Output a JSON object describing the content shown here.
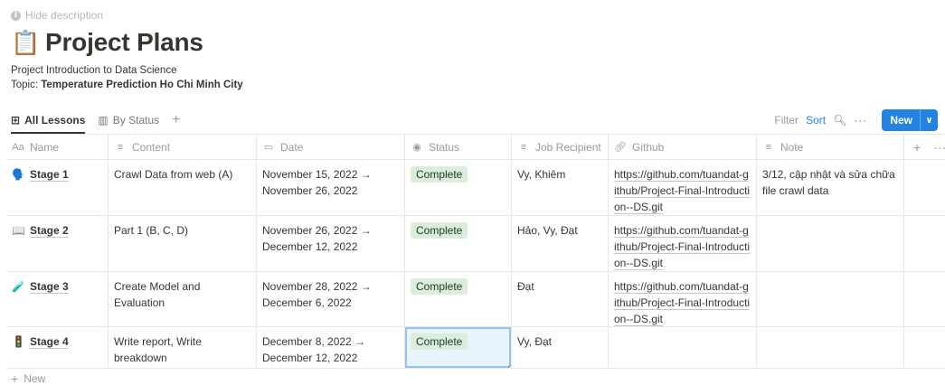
{
  "hide_description": "Hide description",
  "page": {
    "icon": "📋",
    "icon_name": "clipboard-icon",
    "title": "Project Plans",
    "description_line1": "Project Introduction to Data Science",
    "topic_label": "Topic: ",
    "topic_value": "Temperature Prediction Ho Chi Minh City"
  },
  "views": [
    {
      "label": "All Lessons",
      "icon": "table-icon",
      "active": true
    },
    {
      "label": "By Status",
      "icon": "board-icon",
      "active": false
    }
  ],
  "toolbar": {
    "filter": "Filter",
    "sort": "Sort",
    "search_icon": "search-icon",
    "more": "···",
    "new_label": "New",
    "new_chevron": "chevron-down-icon"
  },
  "columns": {
    "name": "Name",
    "content": "Content",
    "date": "Date",
    "status": "Status",
    "job": "Job Recipient",
    "github": "Github",
    "note": "Note"
  },
  "rows": [
    {
      "icon": "🗣️",
      "icon_name": "speaking-head-icon",
      "name": "Stage 1",
      "content": "Crawl Data from web (A)",
      "date": "November 15, 2022 → November 26, 2022",
      "status": "Complete",
      "job": "Vy, Khiêm",
      "github": "https://github.com/tuandat-github/Project-Final-Introduction--DS.git",
      "note": "3/12, cập nhật và sửa chữa file crawl data"
    },
    {
      "icon": "📖",
      "icon_name": "open-book-icon",
      "name": "Stage 2",
      "content": "Part 1 (B, C, D)",
      "date": "November 26, 2022 → December 12, 2022",
      "status": "Complete",
      "job": "Hảo, Vy, Đạt",
      "github": "https://github.com/tuandat-github/Project-Final-Introduction--DS.git",
      "note": ""
    },
    {
      "icon": "🧪",
      "icon_name": "test-tube-icon",
      "name": "Stage 3",
      "content": "Create Model and Evaluation",
      "date": "November 28, 2022 → December 6, 2022",
      "status": "Complete",
      "job": "Đạt",
      "github": "https://github.com/tuandat-github/Project-Final-Introduction--DS.git",
      "note": ""
    },
    {
      "icon": "🚦",
      "icon_name": "traffic-light-icon",
      "name": "Stage 4",
      "content": "Write report, Write breakdown",
      "date": "December 8, 2022 → December 12, 2022",
      "status": "Complete",
      "job": "Vy, Đạt",
      "github": "",
      "note": ""
    }
  ],
  "add_new_row": "New",
  "colors": {
    "accent": "#2383e2",
    "status_complete_bg": "#dbeddb",
    "status_complete_text": "#1c3829",
    "selection_bg": "#e9f3fb"
  }
}
